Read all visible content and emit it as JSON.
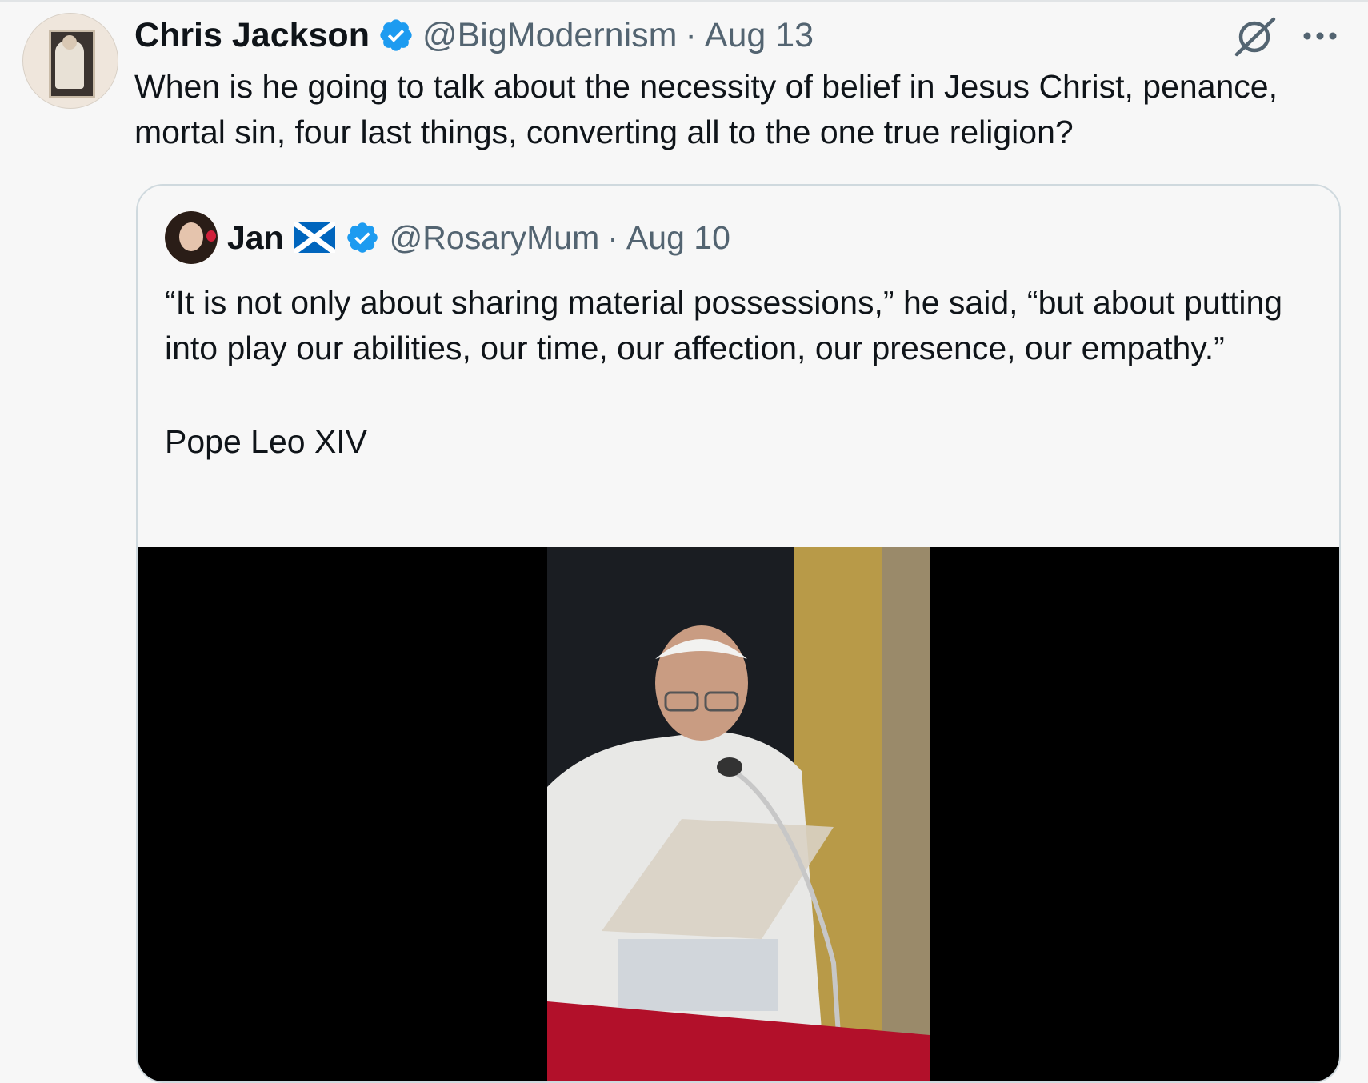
{
  "tweet": {
    "author_name": "Chris Jackson",
    "handle": "@BigModernism",
    "separator": "·",
    "date": "Aug 13",
    "text": "When is he going to talk about the necessity of belief in Jesus Christ, penance, mortal sin, four last things, converting all to the one true religion?"
  },
  "quoted": {
    "author_name": "Jan",
    "handle": "@RosaryMum",
    "separator": "·",
    "date": "Aug 10",
    "text_paragraph_1": "“It is not only about sharing material possessions,” he said, “but about putting into play our abilities, our time, our affection, our presence, our empathy.”",
    "text_paragraph_2": "Pope Leo XIV"
  },
  "icons": {
    "verified": "verified-badge-icon",
    "flag": "scotland-flag-icon",
    "grok": "grok-icon",
    "more": "more-options-icon"
  },
  "colors": {
    "verified_blue": "#1d9bf0",
    "handle_gray": "#536471",
    "text": "#0f1419",
    "background": "#f7f7f7"
  }
}
